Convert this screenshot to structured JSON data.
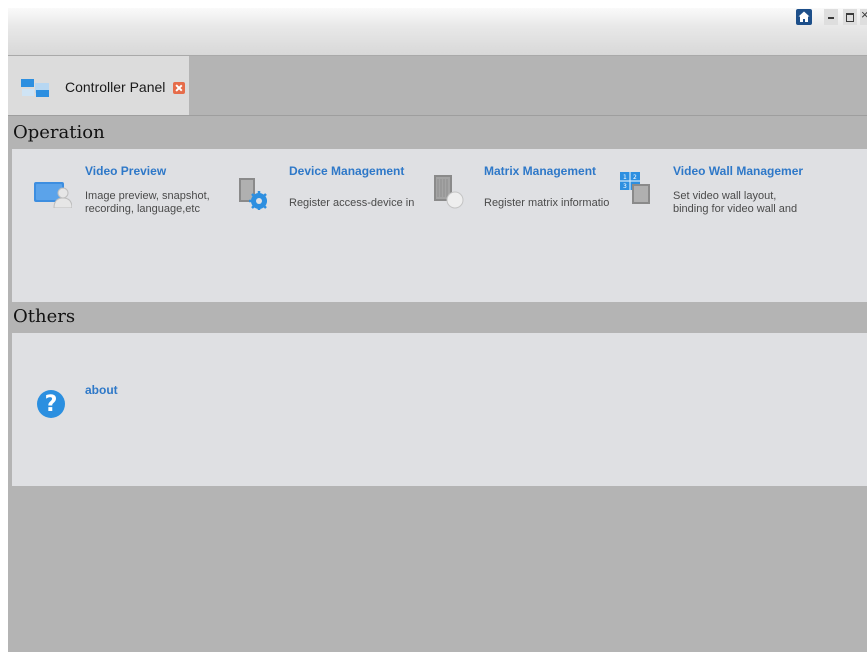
{
  "window": {
    "home_icon": "home-icon",
    "minimize_icon": "minimize-icon",
    "maximize_icon": "maximize-icon",
    "close_icon": "close-icon"
  },
  "tabs": [
    {
      "label": "Controller Panel",
      "icon": "controller-panel-icon",
      "close_icon": "tab-close-icon",
      "active": true
    }
  ],
  "sections": {
    "operation": {
      "title": "Operation",
      "items": [
        {
          "title": "Video Preview",
          "description": [
            "Image preview, snapshot,",
            "recording, language,etc"
          ],
          "icon": "video-preview-icon"
        },
        {
          "title": "Device Management",
          "description": [
            "Register access-device in"
          ],
          "icon": "device-management-icon"
        },
        {
          "title": "Matrix Management",
          "description": [
            "Register matrix informatio"
          ],
          "icon": "matrix-management-icon"
        },
        {
          "title": "Video Wall Managemer",
          "description": [
            "Set video wall layout,",
            "binding for video wall and ’"
          ],
          "icon": "video-wall-icon"
        }
      ]
    },
    "others": {
      "title": "Others",
      "items": [
        {
          "title": "about",
          "icon": "help-icon"
        }
      ]
    }
  },
  "colors": {
    "link_blue": "#2e78c8",
    "panel_bg": "#dfe0e3",
    "frame_gray": "#b4b4b4",
    "close_orange": "#e66c4a",
    "help_blue": "#2b8fe0"
  }
}
